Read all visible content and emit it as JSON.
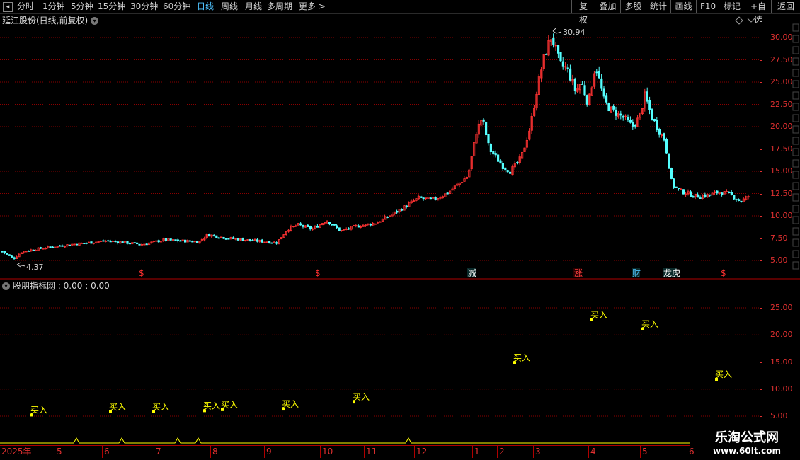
{
  "toolbar": {
    "left_items": [
      "分时",
      "1分钟",
      "5分钟",
      "15分钟",
      "30分钟",
      "60分钟",
      "日线",
      "周线",
      "月线",
      "多周期",
      "更多 >"
    ],
    "active": "日线",
    "right_items": [
      "复权",
      "叠加",
      "多股",
      "统计",
      "画线",
      "F10",
      "标记",
      "+自选",
      "返回"
    ]
  },
  "main_panel": {
    "title": "延江股份(日线,前复权)",
    "high_label": "30.94",
    "low_label": "4.37",
    "y_ticks": [
      "30.00",
      "27.50",
      "25.00",
      "22.50",
      "20.00",
      "17.50",
      "15.00",
      "12.50",
      "10.00",
      "7.50",
      "5.00"
    ],
    "markers": [
      {
        "text": "$",
        "color": "#ff3030"
      },
      {
        "text": "$",
        "color": "#ff3030"
      },
      {
        "text": "减",
        "color": "#ffffff"
      },
      {
        "text": "涨",
        "color": "#ff4040"
      },
      {
        "text": "财",
        "color": "#4fc3ff"
      },
      {
        "text": "龙虎",
        "color": "#ffffff"
      },
      {
        "text": "$",
        "color": "#ff3030"
      }
    ]
  },
  "sub_panel": {
    "title": "股朋指标网 : 0.00 : 0.00",
    "y_ticks": [
      "25.00",
      "20.00",
      "15.00",
      "10.00",
      "5.00"
    ],
    "signal_label": "买入",
    "signals": [
      {
        "y": 5.2
      },
      {
        "y": 5.8
      },
      {
        "y": 5.8
      },
      {
        "y": 6.0
      },
      {
        "y": 6.2
      },
      {
        "y": 6.3
      },
      {
        "y": 7.6
      },
      {
        "y": 14.9
      },
      {
        "y": 22.8
      },
      {
        "y": 21.1
      },
      {
        "y": 11.8
      }
    ]
  },
  "date_axis": [
    "2025年",
    "5",
    "6",
    "7",
    "8",
    "9",
    "10",
    "11",
    "12",
    "1",
    "2",
    "3",
    "4",
    "5",
    "6"
  ],
  "watermark": {
    "line1": "乐淘公式网",
    "line2": "www.60lt.com"
  },
  "colors": {
    "up": "#ff3232",
    "down": "#54ffff",
    "axis": "#e03030",
    "grid": "#8b0000",
    "signal": "#ffff00"
  }
}
